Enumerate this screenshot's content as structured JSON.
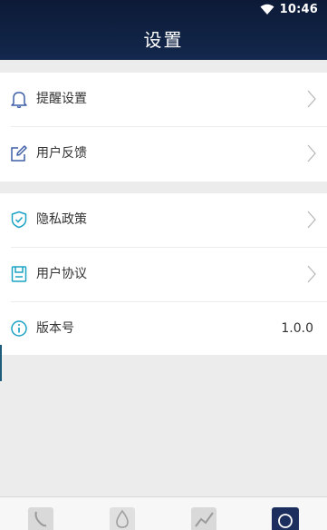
{
  "statusbar": {
    "time": "10:46"
  },
  "header": {
    "title": "设置"
  },
  "section1": [
    {
      "label": "提醒设置",
      "icon": "bell-icon"
    },
    {
      "label": "用户反馈",
      "icon": "edit-icon"
    }
  ],
  "section2": [
    {
      "label": "隐私政策",
      "icon": "shield-check-icon"
    },
    {
      "label": "用户协议",
      "icon": "document-icon"
    },
    {
      "label": "版本号",
      "icon": "info-icon",
      "value": "1.0.0"
    }
  ],
  "tabbar": {
    "tabs": [
      "phone-icon",
      "drop-icon",
      "chart-icon",
      "profile-icon"
    ],
    "active_index": 3
  },
  "colors": {
    "header": "#13284d",
    "icon_blue": "#3e5fa8",
    "icon_teal": "#1aa3c4",
    "active_tab": "#1c2e5e"
  }
}
